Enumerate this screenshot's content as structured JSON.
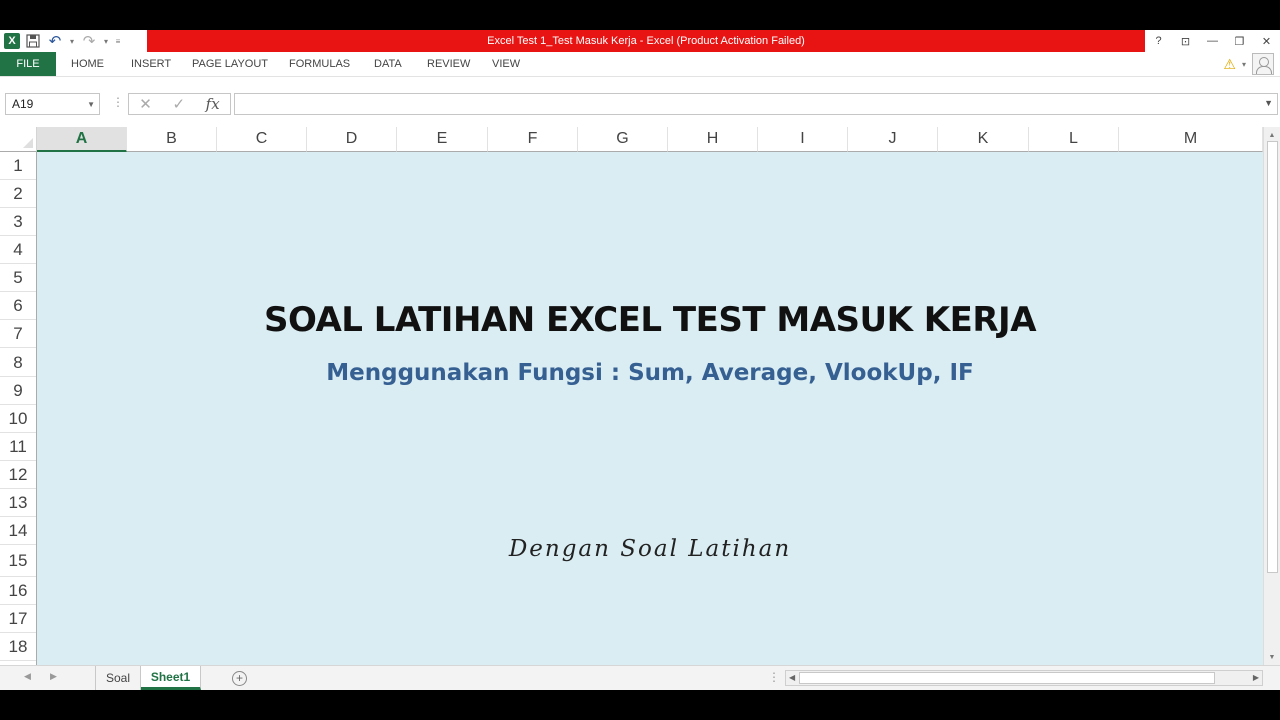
{
  "window": {
    "title": "Excel Test 1_Test Masuk Kerja -  Excel (Product Activation Failed)",
    "controls": [
      "?",
      "⊡",
      "—",
      "❐",
      "✕"
    ]
  },
  "qat": {
    "icons": [
      "excel-logo",
      "save-icon",
      "undo-icon",
      "redo-icon",
      "customize-icon"
    ]
  },
  "ribbon": {
    "tabs": [
      "FILE",
      "HOME",
      "INSERT",
      "PAGE LAYOUT",
      "FORMULAS",
      "DATA",
      "REVIEW",
      "VIEW"
    ]
  },
  "formula_bar": {
    "name_box": "A19",
    "formula": ""
  },
  "grid": {
    "columns": [
      "A",
      "B",
      "C",
      "D",
      "E",
      "F",
      "G",
      "H",
      "I",
      "J",
      "K",
      "L",
      "M"
    ],
    "active_column": "A",
    "rows": [
      "1",
      "2",
      "3",
      "4",
      "5",
      "6",
      "7",
      "8",
      "9",
      "10",
      "11",
      "12",
      "13",
      "14",
      "15",
      "16",
      "17",
      "18"
    ],
    "background_color": "#daedf3"
  },
  "content": {
    "title": "SOAL LATIHAN EXCEL TEST MASUK KERJA",
    "subtitle": "Menggunakan Fungsi : Sum, Average, VlookUp, IF",
    "note": "Dengan Soal Latihan"
  },
  "sheets": {
    "tabs": [
      "Soal",
      "Sheet1"
    ],
    "active": "Sheet1"
  },
  "colors": {
    "accent": "#217346",
    "title_bar": "#e81414",
    "subtitle": "#366092"
  }
}
